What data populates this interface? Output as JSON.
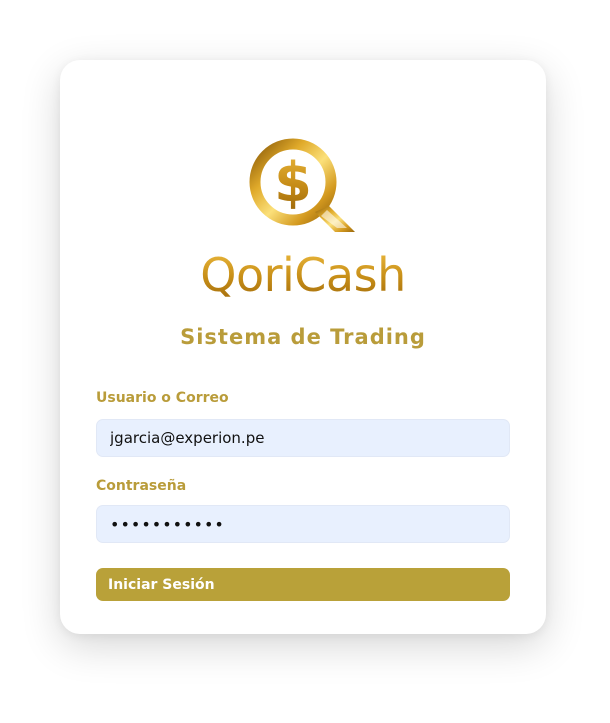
{
  "brand": {
    "name": "QoriCash",
    "logo_icon": "dollar-q-logo-icon",
    "colors": {
      "gold_light": "#f6d26a",
      "gold": "#d6a32a",
      "gold_dark": "#a8710e"
    }
  },
  "subtitle": "Sistema de Trading",
  "form": {
    "user_label": "Usuario o Correo",
    "user_value": "jgarcia@experion.pe",
    "password_label": "Contraseña",
    "password_value": "•••••••••••",
    "submit_label": "Iniciar Sesión"
  },
  "colors": {
    "accent": "#b9a139",
    "label": "#b99c3a",
    "input_bg": "#e8f0fe"
  }
}
